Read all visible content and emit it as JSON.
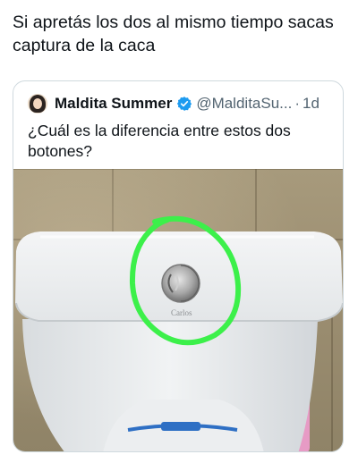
{
  "post": {
    "text": "Si apretás los dos al mismo tiempo sacas captura de la caca"
  },
  "quote": {
    "author_name": "Maldita Summer",
    "handle": "@MalditaSu...",
    "separator": "·",
    "time": "1d",
    "text": "¿Cuál es la diferencia entre estos dos botones?",
    "image": {
      "flush_brand_text": "Carlos",
      "circle_color": "#3cf04a"
    }
  },
  "icons": {
    "verified": "verified-badge-icon",
    "avatar": "profile-avatar"
  },
  "colors": {
    "verified": "#1d9bf0",
    "secondary_text": "#536471",
    "border": "#cfd9de"
  }
}
